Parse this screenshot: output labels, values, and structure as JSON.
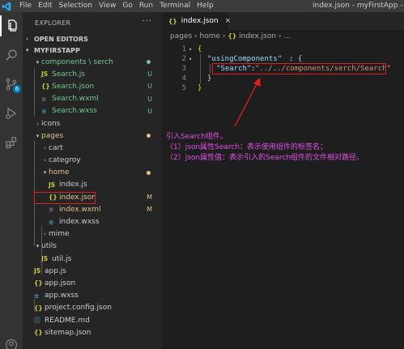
{
  "menu": {
    "items": [
      "File",
      "Edit",
      "Selection",
      "View",
      "Go",
      "Run",
      "Terminal",
      "Help"
    ],
    "window_title": "index.json - myFirstApp - Visual Studio Code"
  },
  "activity": {
    "scm_badge": "6"
  },
  "sidebar": {
    "title": "EXPLORER",
    "more": "···",
    "open_editors": "OPEN EDITORS",
    "project": "MYFIRSTAPP"
  },
  "tree": [
    {
      "label": "components \\ serch",
      "type": "folder",
      "status": "dot",
      "color": "#73c991"
    },
    {
      "label": "Search.js",
      "type": "js",
      "status": "U",
      "color": "#73c991"
    },
    {
      "label": "Search.json",
      "type": "json",
      "status": "U",
      "color": "#73c991"
    },
    {
      "label": "Search.wxml",
      "type": "wxml",
      "status": "U",
      "color": "#73c991"
    },
    {
      "label": "Search.wxss",
      "type": "wxss",
      "status": "U",
      "color": "#73c991"
    },
    {
      "label": "icons",
      "type": "folder"
    },
    {
      "label": "pages",
      "type": "folder",
      "status": "dot",
      "color": "#e2c08d"
    },
    {
      "label": "cart",
      "type": "folder"
    },
    {
      "label": "categroy",
      "type": "folder"
    },
    {
      "label": "home",
      "type": "folder",
      "status": "dot",
      "color": "#e2c08d"
    },
    {
      "label": "index.js",
      "type": "js"
    },
    {
      "label": "index.json",
      "type": "json",
      "status": "M",
      "color": "#e2c08d"
    },
    {
      "label": "index.wxml",
      "type": "wxml",
      "status": "M",
      "color": "#e2c08d"
    },
    {
      "label": "index.wxss",
      "type": "wxss"
    },
    {
      "label": "mime",
      "type": "folder"
    },
    {
      "label": "utils",
      "type": "folder"
    },
    {
      "label": "util.js",
      "type": "js"
    },
    {
      "label": "app.js",
      "type": "js"
    },
    {
      "label": "app.json",
      "type": "json"
    },
    {
      "label": "app.wxss",
      "type": "wxss"
    },
    {
      "label": "project.config.json",
      "type": "json"
    },
    {
      "label": "README.md",
      "type": "md"
    },
    {
      "label": "sitemap.json",
      "type": "json"
    }
  ],
  "icons": {
    "js": "JS",
    "json": "{}",
    "folder_open": "▾",
    "folder_closed": "›"
  },
  "editor": {
    "tab_label": "index.json",
    "tab_close": "×",
    "breadcrumb": [
      "pages",
      "home",
      "index.json",
      "..."
    ],
    "lines": [
      {
        "n": "1",
        "t": "{"
      },
      {
        "n": "2",
        "t": "\"usingComponents\": {"
      },
      {
        "n": "3",
        "t": "\"Search\":\"../../components/serch/Search\""
      },
      {
        "n": "4",
        "t": "}"
      },
      {
        "n": "5",
        "t": "}"
      }
    ],
    "code": {
      "key1": "\"usingComponents\"",
      "colon_brace": ": {",
      "key2": "\"Search\"",
      "colon": ":",
      "value": "\"../../components/serch/Search\""
    }
  },
  "annotation": [
    "引入Search组件。",
    "（1）json属性Search：表示使用组件的标签名；",
    "（2）json属性值：表示引入的Search组件的文件相对路径。"
  ],
  "colors": {
    "accent": "#007acc",
    "highlight_box": "#e0201e",
    "annotation_text": "#e14fe8"
  }
}
